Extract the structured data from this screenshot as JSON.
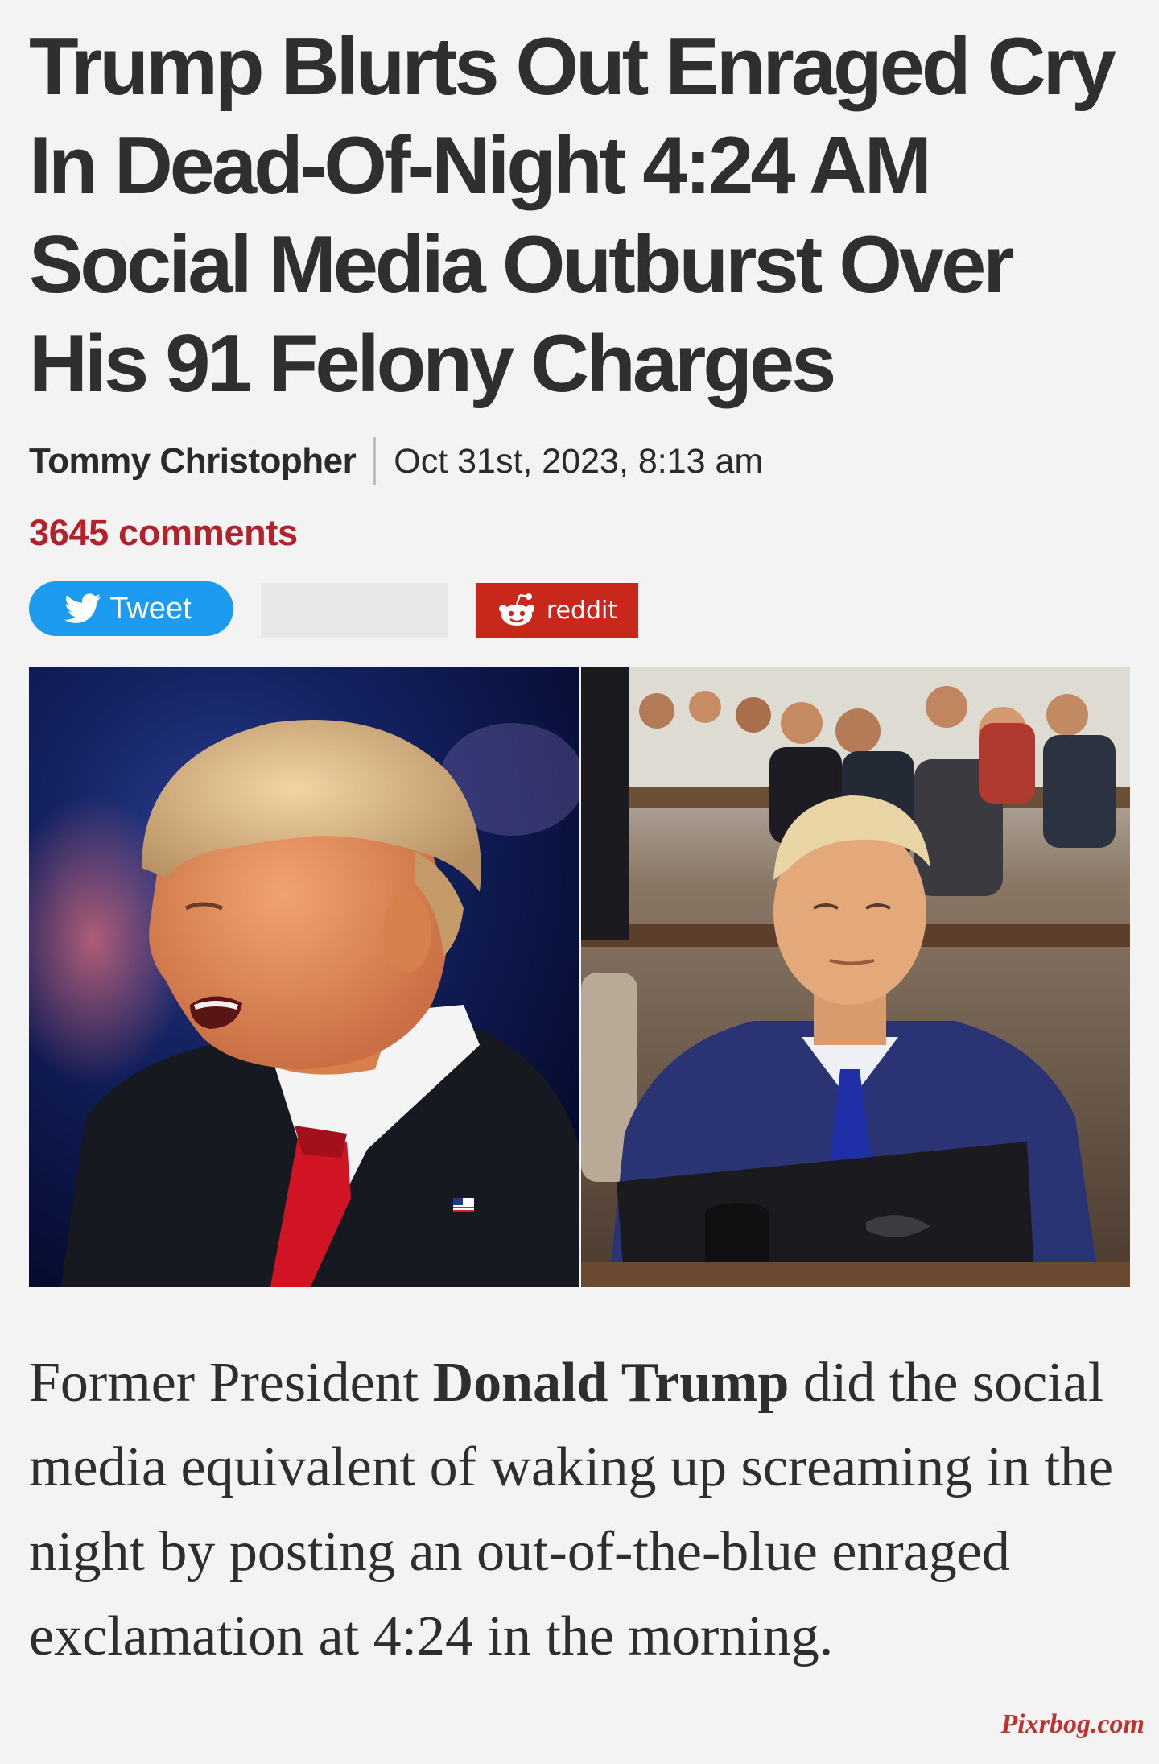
{
  "article": {
    "headline": "Trump Blurts Out Enraged Cry In Dead-Of-Night 4:24 AM Social Media Outburst Over His 91 Felony Charges",
    "author": "Tommy Christopher",
    "date": "Oct 31st, 2023, 8:13 am",
    "comments_label": "3645 comments",
    "lede": {
      "before": "Former President ",
      "bold": "Donald Trump",
      "after": " did the social media equivalent of waking up screaming in the night by posting an out-of-the-blue enraged exclamation at 4:24 in the morning."
    }
  },
  "share": {
    "tweet_label": "Tweet",
    "tweet_icon": "twitter-bird-icon",
    "reddit_label": "reddit",
    "reddit_icon": "reddit-alien-icon"
  },
  "hero_image": {
    "panels": [
      "left-speaking-portrait",
      "right-courtroom-seated"
    ]
  },
  "watermark": "Pixrbog.com",
  "colors": {
    "background": "#f3f3f3",
    "headline": "#2f2f2f",
    "comments": "#b3222a",
    "tweet": "#1d9bf0",
    "reddit": "#c8271c",
    "watermark": "#c0302e"
  }
}
